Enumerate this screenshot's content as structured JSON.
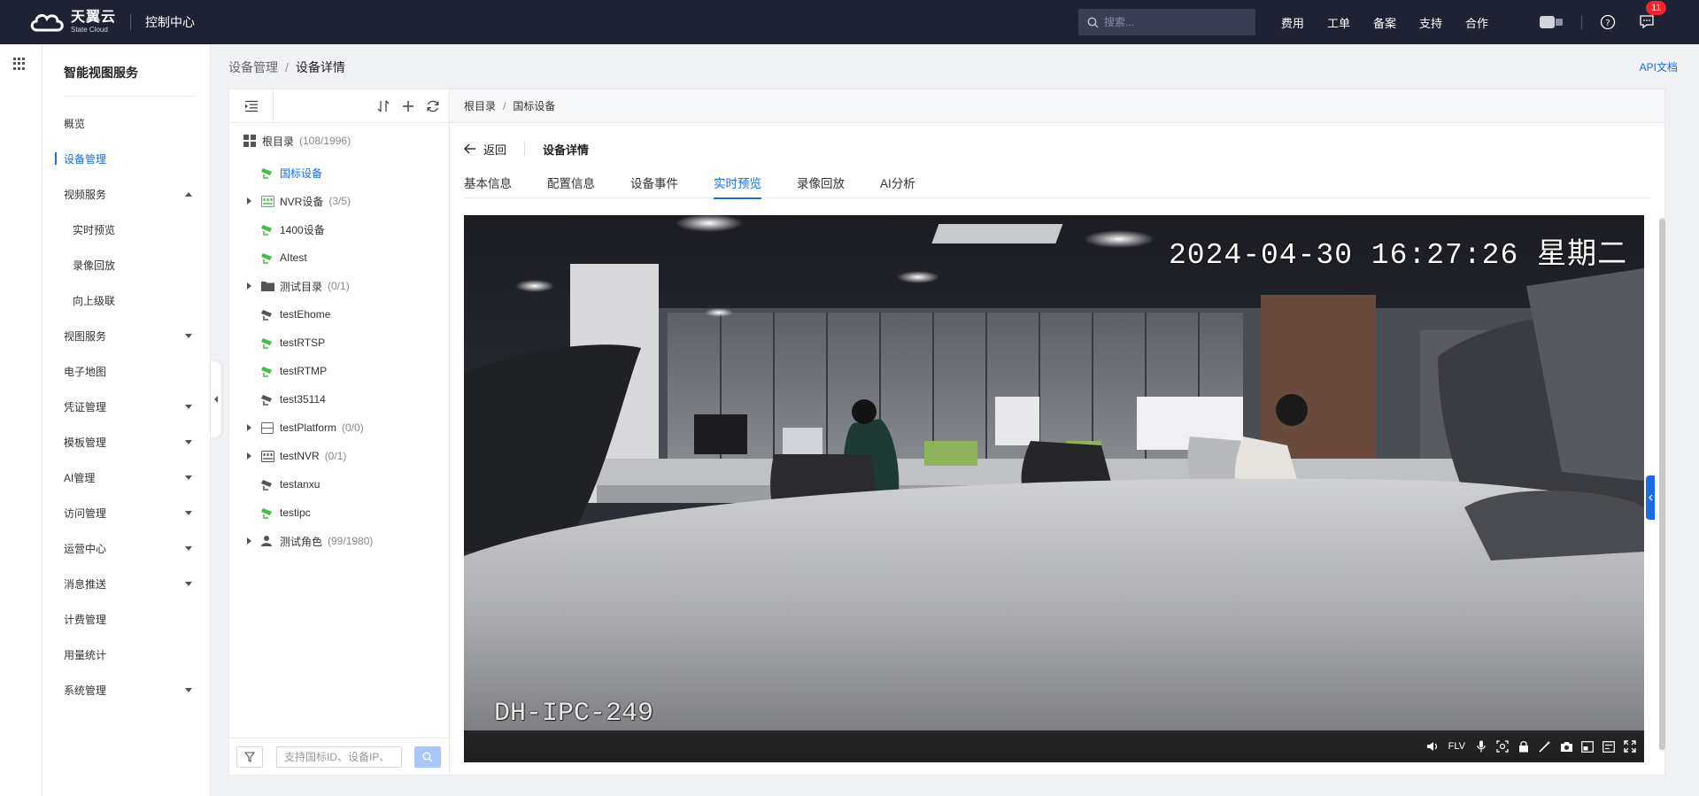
{
  "topbar": {
    "logo_cn": "天翼云",
    "logo_en": "State Cloud",
    "console": "控制中心",
    "search_placeholder": "搜索...",
    "nav": [
      "费用",
      "工单",
      "备案",
      "支持",
      "合作"
    ],
    "message_count": "11"
  },
  "sidebar": {
    "title": "智能视图服务",
    "items": [
      {
        "label": "概览"
      },
      {
        "label": "设备管理"
      },
      {
        "label": "视频服务"
      },
      {
        "label": "实时预览"
      },
      {
        "label": "录像回放"
      },
      {
        "label": "向上级联"
      },
      {
        "label": "视图服务"
      },
      {
        "label": "电子地图"
      },
      {
        "label": "凭证管理"
      },
      {
        "label": "模板管理"
      },
      {
        "label": "AI管理"
      },
      {
        "label": "访问管理"
      },
      {
        "label": "运营中心"
      },
      {
        "label": "消息推送"
      },
      {
        "label": "计费管理"
      },
      {
        "label": "用量统计"
      },
      {
        "label": "系统管理"
      }
    ]
  },
  "breadcrumb": {
    "parent": "设备管理",
    "current": "设备详情",
    "separator": "/"
  },
  "api_doc": "API文档",
  "tree": {
    "root": {
      "label": "根目录",
      "count": "(108/1996)"
    },
    "nodes": [
      {
        "label": "国标设备",
        "count": ""
      },
      {
        "label": "NVR设备",
        "count": "(3/5)"
      },
      {
        "label": "1400设备",
        "count": ""
      },
      {
        "label": "AItest",
        "count": ""
      },
      {
        "label": "测试目录",
        "count": "(0/1)"
      },
      {
        "label": "testEhome",
        "count": ""
      },
      {
        "label": "testRTSP",
        "count": ""
      },
      {
        "label": "testRTMP",
        "count": ""
      },
      {
        "label": "test35114",
        "count": ""
      },
      {
        "label": "testPlatform",
        "count": "(0/0)"
      },
      {
        "label": "testNVR",
        "count": "(0/1)"
      },
      {
        "label": "testanxu",
        "count": ""
      },
      {
        "label": "testipc",
        "count": ""
      },
      {
        "label": "测试角色",
        "count": "(99/1980)"
      }
    ],
    "search_placeholder": "支持国标ID、设备IP、"
  },
  "main": {
    "crumb_root": "根目录",
    "crumb_current": "国标设备",
    "separator": "/",
    "back": "返回",
    "detail_title": "设备详情",
    "tabs": [
      "基本信息",
      "配置信息",
      "设备事件",
      "实时预览",
      "录像回放",
      "AI分析"
    ]
  },
  "video": {
    "timestamp": "2024-04-30 16:27:26 星期二",
    "device_name": "DH-IPC-249",
    "format": "FLV"
  },
  "colors": {
    "accent": "#1a6ce8",
    "topbar": "#1f2233",
    "online": "#3cc13b",
    "offline": "#555555"
  }
}
